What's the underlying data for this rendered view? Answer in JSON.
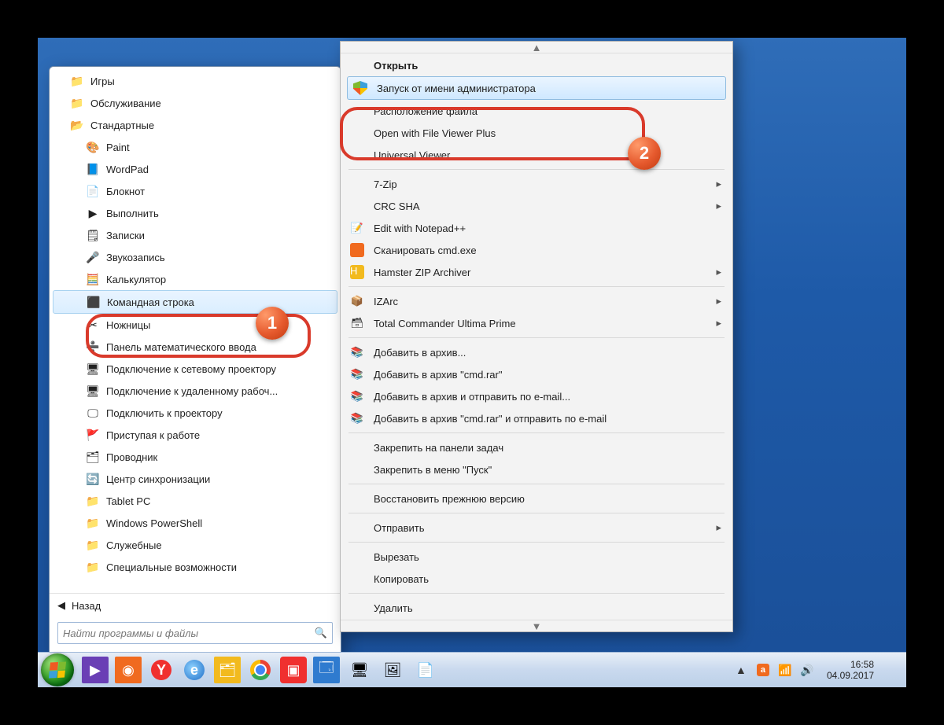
{
  "start_menu": {
    "folders": {
      "games": "Игры",
      "maintenance": "Обслуживание",
      "accessories": "Стандартные",
      "tablet": "Tablet PC",
      "powershell": "Windows PowerShell",
      "service": "Служебные",
      "access": "Специальные возможности"
    },
    "items": {
      "paint": "Paint",
      "wordpad": "WordPad",
      "notepad": "Блокнот",
      "run": "Выполнить",
      "sticky": "Записки",
      "soundrec": "Звукозапись",
      "calc": "Калькулятор",
      "cmd": "Командная строка",
      "snip": "Ножницы",
      "mathpanel": "Панель математического ввода",
      "netproj": "Подключение к сетевому проектору",
      "rdp": "Подключение к удаленному рабоч...",
      "projector": "Подключить к проектору",
      "getstarted": "Приступая к работе",
      "explorer": "Проводник",
      "sync": "Центр синхронизации"
    },
    "back": "Назад",
    "search_placeholder": "Найти программы и файлы"
  },
  "context_menu": {
    "open": "Открыть",
    "run_admin": "Запуск от имени администратора",
    "file_location": "Расположение файла",
    "fileviewer": "Open with File Viewer Plus",
    "uviewer": "Universal Viewer",
    "sevenzip": "7-Zip",
    "crcsha": "CRC SHA",
    "npp": "Edit with Notepad++",
    "scan": "Сканировать cmd.exe",
    "hamster": "Hamster ZIP Archiver",
    "izarc": "IZArc",
    "tcup": "Total Commander Ultima Prime",
    "rar_add": "Добавить в архив...",
    "rar_cmd": "Добавить в архив \"cmd.rar\"",
    "rar_mail": "Добавить в архив и отправить по e-mail...",
    "rar_cmd_mail": "Добавить в архив \"cmd.rar\" и отправить по e-mail",
    "pin_taskbar": "Закрепить на панели задач",
    "pin_start": "Закрепить в меню \"Пуск\"",
    "restore": "Восстановить прежнюю версию",
    "sendto": "Отправить",
    "cut": "Вырезать",
    "copy": "Копировать",
    "delete": "Удалить"
  },
  "callouts": {
    "one": "1",
    "two": "2"
  },
  "clock": {
    "time": "16:58",
    "date": "04.09.2017"
  },
  "tray_letter": "a"
}
